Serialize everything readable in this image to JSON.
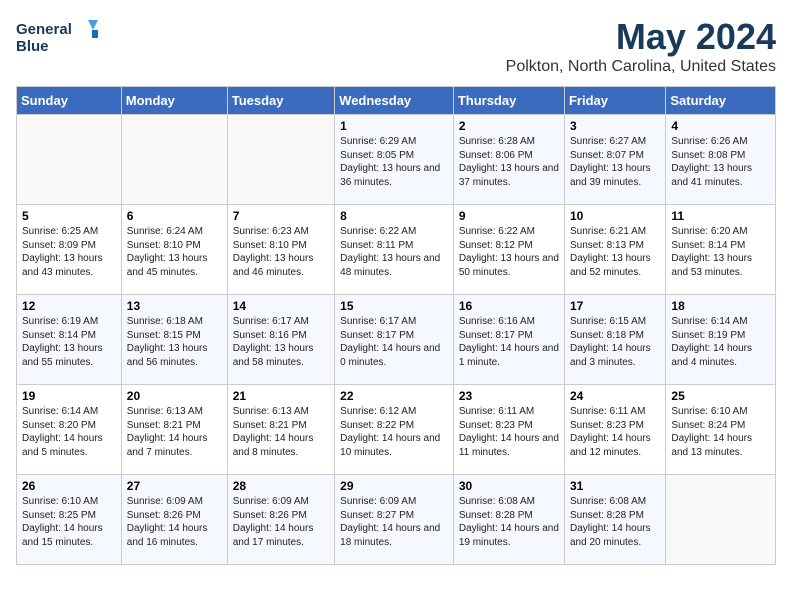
{
  "logo": {
    "line1": "General",
    "line2": "Blue"
  },
  "title": "May 2024",
  "subtitle": "Polkton, North Carolina, United States",
  "days_of_week": [
    "Sunday",
    "Monday",
    "Tuesday",
    "Wednesday",
    "Thursday",
    "Friday",
    "Saturday"
  ],
  "weeks": [
    [
      {
        "day": "",
        "sunrise": "",
        "sunset": "",
        "daylight": ""
      },
      {
        "day": "",
        "sunrise": "",
        "sunset": "",
        "daylight": ""
      },
      {
        "day": "",
        "sunrise": "",
        "sunset": "",
        "daylight": ""
      },
      {
        "day": "1",
        "sunrise": "Sunrise: 6:29 AM",
        "sunset": "Sunset: 8:05 PM",
        "daylight": "Daylight: 13 hours and 36 minutes."
      },
      {
        "day": "2",
        "sunrise": "Sunrise: 6:28 AM",
        "sunset": "Sunset: 8:06 PM",
        "daylight": "Daylight: 13 hours and 37 minutes."
      },
      {
        "day": "3",
        "sunrise": "Sunrise: 6:27 AM",
        "sunset": "Sunset: 8:07 PM",
        "daylight": "Daylight: 13 hours and 39 minutes."
      },
      {
        "day": "4",
        "sunrise": "Sunrise: 6:26 AM",
        "sunset": "Sunset: 8:08 PM",
        "daylight": "Daylight: 13 hours and 41 minutes."
      }
    ],
    [
      {
        "day": "5",
        "sunrise": "Sunrise: 6:25 AM",
        "sunset": "Sunset: 8:09 PM",
        "daylight": "Daylight: 13 hours and 43 minutes."
      },
      {
        "day": "6",
        "sunrise": "Sunrise: 6:24 AM",
        "sunset": "Sunset: 8:10 PM",
        "daylight": "Daylight: 13 hours and 45 minutes."
      },
      {
        "day": "7",
        "sunrise": "Sunrise: 6:23 AM",
        "sunset": "Sunset: 8:10 PM",
        "daylight": "Daylight: 13 hours and 46 minutes."
      },
      {
        "day": "8",
        "sunrise": "Sunrise: 6:22 AM",
        "sunset": "Sunset: 8:11 PM",
        "daylight": "Daylight: 13 hours and 48 minutes."
      },
      {
        "day": "9",
        "sunrise": "Sunrise: 6:22 AM",
        "sunset": "Sunset: 8:12 PM",
        "daylight": "Daylight: 13 hours and 50 minutes."
      },
      {
        "day": "10",
        "sunrise": "Sunrise: 6:21 AM",
        "sunset": "Sunset: 8:13 PM",
        "daylight": "Daylight: 13 hours and 52 minutes."
      },
      {
        "day": "11",
        "sunrise": "Sunrise: 6:20 AM",
        "sunset": "Sunset: 8:14 PM",
        "daylight": "Daylight: 13 hours and 53 minutes."
      }
    ],
    [
      {
        "day": "12",
        "sunrise": "Sunrise: 6:19 AM",
        "sunset": "Sunset: 8:14 PM",
        "daylight": "Daylight: 13 hours and 55 minutes."
      },
      {
        "day": "13",
        "sunrise": "Sunrise: 6:18 AM",
        "sunset": "Sunset: 8:15 PM",
        "daylight": "Daylight: 13 hours and 56 minutes."
      },
      {
        "day": "14",
        "sunrise": "Sunrise: 6:17 AM",
        "sunset": "Sunset: 8:16 PM",
        "daylight": "Daylight: 13 hours and 58 minutes."
      },
      {
        "day": "15",
        "sunrise": "Sunrise: 6:17 AM",
        "sunset": "Sunset: 8:17 PM",
        "daylight": "Daylight: 14 hours and 0 minutes."
      },
      {
        "day": "16",
        "sunrise": "Sunrise: 6:16 AM",
        "sunset": "Sunset: 8:17 PM",
        "daylight": "Daylight: 14 hours and 1 minute."
      },
      {
        "day": "17",
        "sunrise": "Sunrise: 6:15 AM",
        "sunset": "Sunset: 8:18 PM",
        "daylight": "Daylight: 14 hours and 3 minutes."
      },
      {
        "day": "18",
        "sunrise": "Sunrise: 6:14 AM",
        "sunset": "Sunset: 8:19 PM",
        "daylight": "Daylight: 14 hours and 4 minutes."
      }
    ],
    [
      {
        "day": "19",
        "sunrise": "Sunrise: 6:14 AM",
        "sunset": "Sunset: 8:20 PM",
        "daylight": "Daylight: 14 hours and 5 minutes."
      },
      {
        "day": "20",
        "sunrise": "Sunrise: 6:13 AM",
        "sunset": "Sunset: 8:21 PM",
        "daylight": "Daylight: 14 hours and 7 minutes."
      },
      {
        "day": "21",
        "sunrise": "Sunrise: 6:13 AM",
        "sunset": "Sunset: 8:21 PM",
        "daylight": "Daylight: 14 hours and 8 minutes."
      },
      {
        "day": "22",
        "sunrise": "Sunrise: 6:12 AM",
        "sunset": "Sunset: 8:22 PM",
        "daylight": "Daylight: 14 hours and 10 minutes."
      },
      {
        "day": "23",
        "sunrise": "Sunrise: 6:11 AM",
        "sunset": "Sunset: 8:23 PM",
        "daylight": "Daylight: 14 hours and 11 minutes."
      },
      {
        "day": "24",
        "sunrise": "Sunrise: 6:11 AM",
        "sunset": "Sunset: 8:23 PM",
        "daylight": "Daylight: 14 hours and 12 minutes."
      },
      {
        "day": "25",
        "sunrise": "Sunrise: 6:10 AM",
        "sunset": "Sunset: 8:24 PM",
        "daylight": "Daylight: 14 hours and 13 minutes."
      }
    ],
    [
      {
        "day": "26",
        "sunrise": "Sunrise: 6:10 AM",
        "sunset": "Sunset: 8:25 PM",
        "daylight": "Daylight: 14 hours and 15 minutes."
      },
      {
        "day": "27",
        "sunrise": "Sunrise: 6:09 AM",
        "sunset": "Sunset: 8:26 PM",
        "daylight": "Daylight: 14 hours and 16 minutes."
      },
      {
        "day": "28",
        "sunrise": "Sunrise: 6:09 AM",
        "sunset": "Sunset: 8:26 PM",
        "daylight": "Daylight: 14 hours and 17 minutes."
      },
      {
        "day": "29",
        "sunrise": "Sunrise: 6:09 AM",
        "sunset": "Sunset: 8:27 PM",
        "daylight": "Daylight: 14 hours and 18 minutes."
      },
      {
        "day": "30",
        "sunrise": "Sunrise: 6:08 AM",
        "sunset": "Sunset: 8:28 PM",
        "daylight": "Daylight: 14 hours and 19 minutes."
      },
      {
        "day": "31",
        "sunrise": "Sunrise: 6:08 AM",
        "sunset": "Sunset: 8:28 PM",
        "daylight": "Daylight: 14 hours and 20 minutes."
      },
      {
        "day": "",
        "sunrise": "",
        "sunset": "",
        "daylight": ""
      }
    ]
  ]
}
